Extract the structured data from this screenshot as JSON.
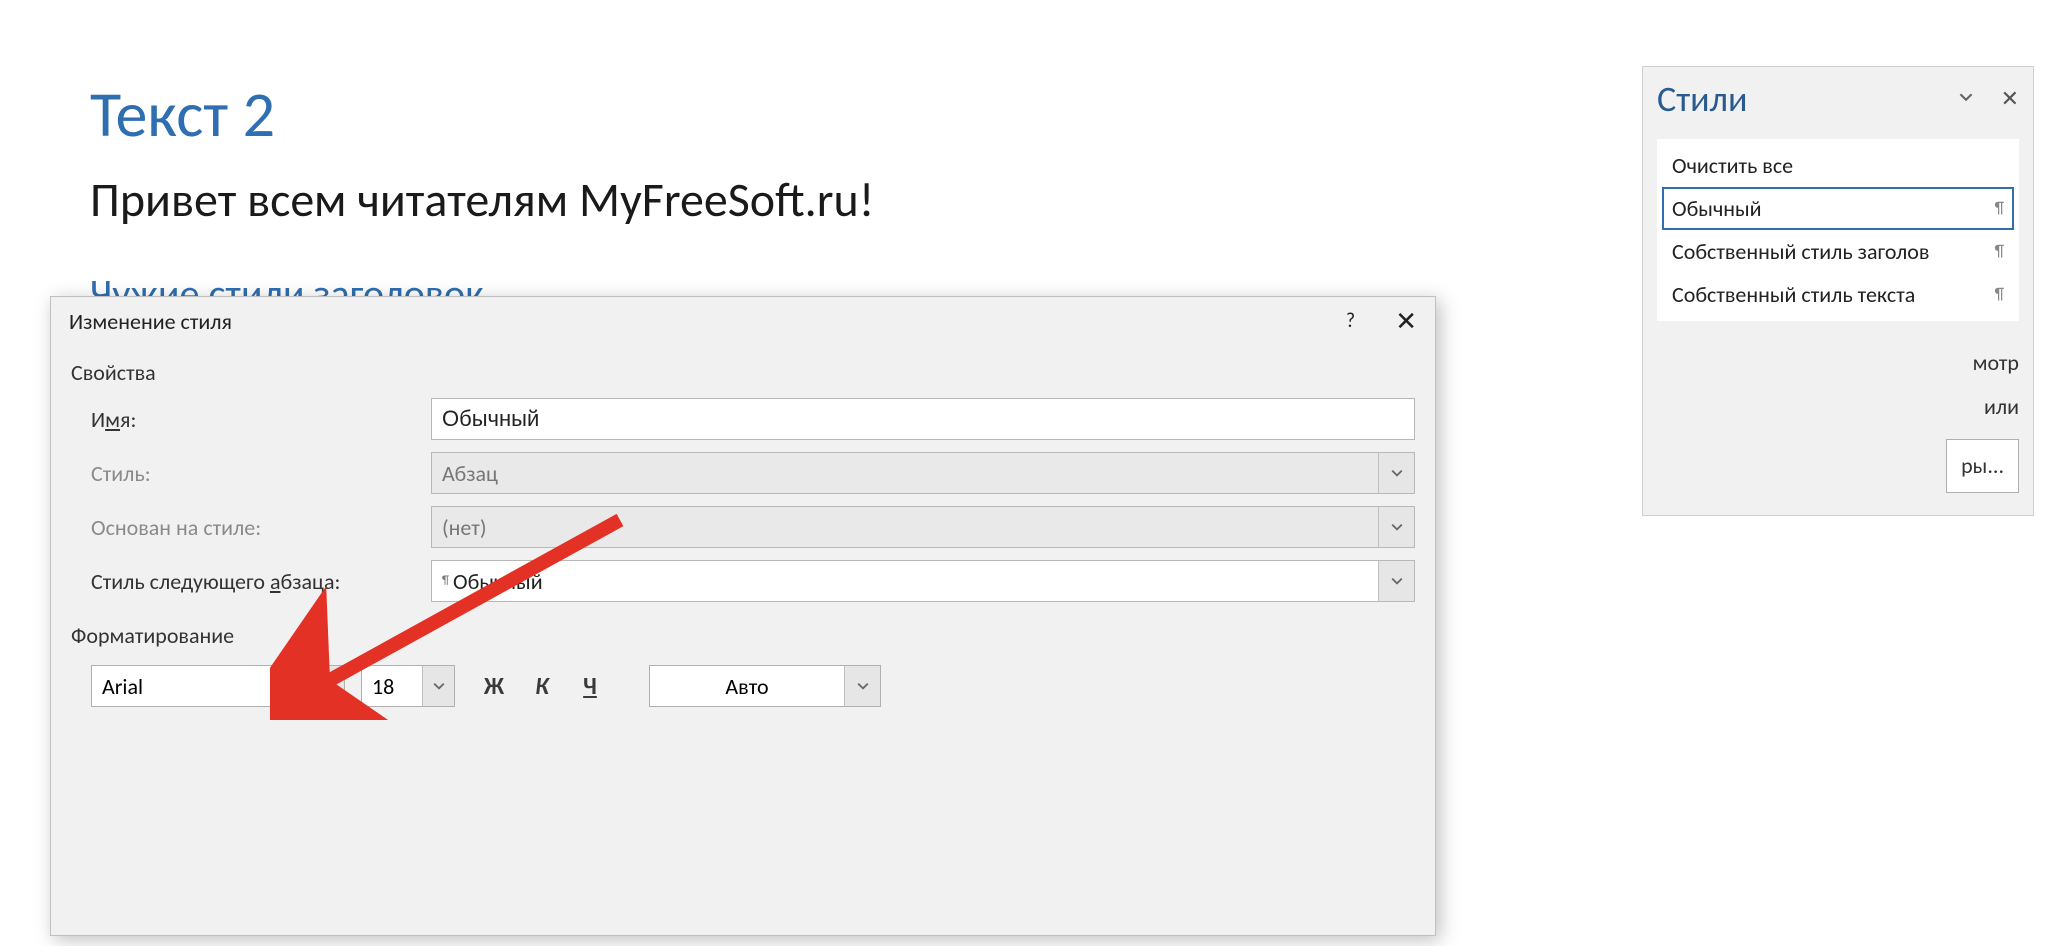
{
  "document": {
    "title": "Текст 2",
    "body_line": "Привет всем читателям MyFreeSoft.ru!",
    "sub_heading": "Чужие стили заголовок"
  },
  "styles_pane": {
    "title": "Стили",
    "items": [
      {
        "label": "Очистить все",
        "selected": false,
        "para_marker": ""
      },
      {
        "label": "Обычный",
        "selected": true,
        "para_marker": "¶"
      },
      {
        "label": "Собственный стиль заголов",
        "selected": false,
        "para_marker": "¶"
      },
      {
        "label": "Собственный стиль текста",
        "selected": false,
        "para_marker": "¶"
      }
    ],
    "tail_lines": [
      "мотр",
      "или"
    ],
    "options_button": "ры..."
  },
  "dialog": {
    "title": "Изменение стиля",
    "help_icon": "?",
    "close_icon": "✕",
    "group_properties": "Свойства",
    "rows": {
      "name_label_pre": "И",
      "name_label_hot": "м",
      "name_label_post": "я:",
      "name_value": "Обычный",
      "style_type_label": "Стиль:",
      "style_type_value": "Абзац",
      "based_on_label": "Основан на стиле:",
      "based_on_value": "(нет)",
      "next_label_pre": "Стиль следующего ",
      "next_label_hot": "а",
      "next_label_post": "бзаца:",
      "next_value": "Обычный"
    },
    "group_formatting": "Форматирование",
    "formatting": {
      "font": "Arial",
      "size": "18",
      "bold": "Ж",
      "italic": "К",
      "underline": "Ч",
      "color": "Авто"
    }
  }
}
